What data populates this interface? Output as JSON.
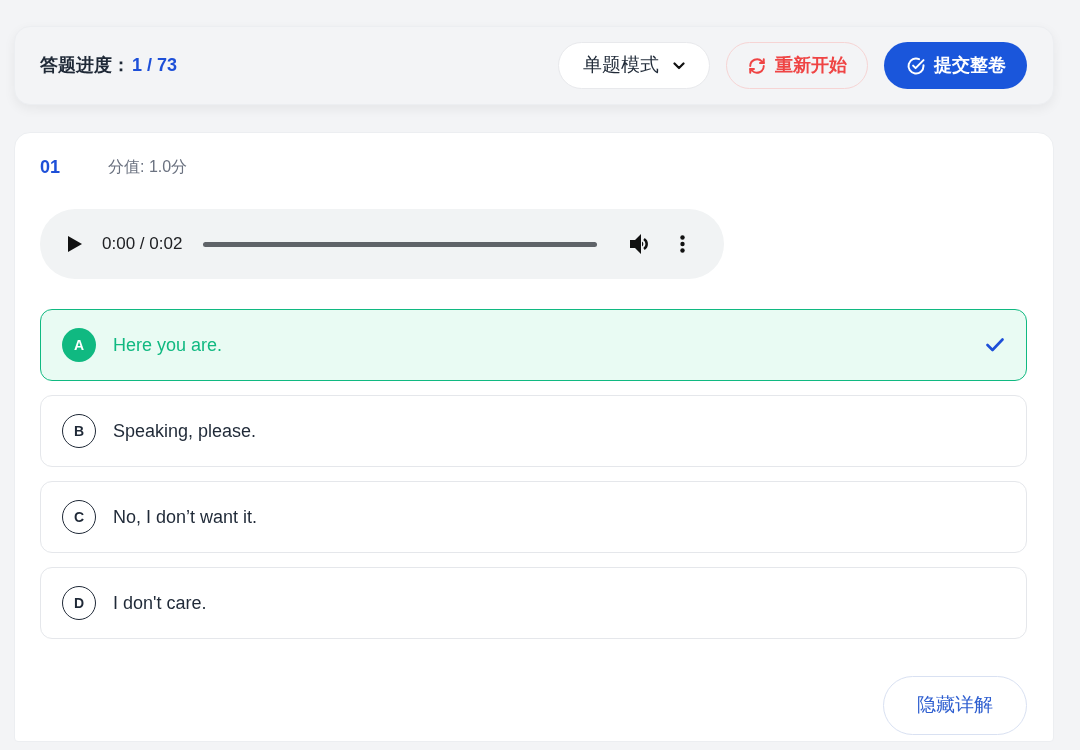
{
  "progress": {
    "label": "答题进度：",
    "value": "1 / 73"
  },
  "mode_select": {
    "value": "单题模式"
  },
  "buttons": [
    {
      "kind": "restart",
      "label": "重新开始"
    },
    {
      "kind": "submit",
      "label": "提交整卷"
    }
  ],
  "question": {
    "number": "01",
    "score": "分值: 1.0分",
    "audio": {
      "time": "0:00 / 0:02"
    },
    "options": [
      {
        "letter": "A",
        "text": "Here you are.",
        "selected": true
      },
      {
        "letter": "B",
        "text": "Speaking, please.",
        "selected": false
      },
      {
        "letter": "C",
        "text": "No, I don’t want it.",
        "selected": false
      },
      {
        "letter": "D",
        "text": "I don't care.",
        "selected": false
      }
    ],
    "detail_button": "隐藏详解"
  }
}
